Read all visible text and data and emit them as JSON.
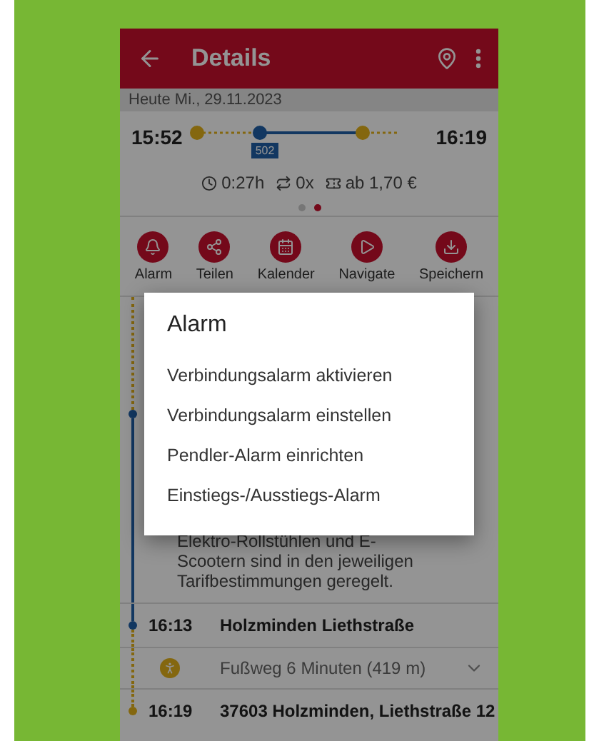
{
  "app_bar": {
    "title": "Details"
  },
  "date": "Heute Mi., 29.11.2023",
  "summary": {
    "departure": "15:52",
    "arrival": "16:19",
    "line": "502",
    "duration": "0:27h",
    "changes": "0x",
    "price": "ab 1,70 €",
    "pages": [
      {
        "selected": false
      },
      {
        "selected": true
      }
    ]
  },
  "actions": [
    {
      "label": "Alarm",
      "kind": "bell"
    },
    {
      "label": "Teilen",
      "kind": "share"
    },
    {
      "label": "Kalender",
      "kind": "calendar"
    },
    {
      "label": "Navigate",
      "kind": "play"
    },
    {
      "label": "Speichern",
      "kind": "save"
    }
  ],
  "note": "Elektro-Rollstühlen und E-Scootern sind in den jeweiligen Tarifbestimmungen geregelt.",
  "legs": [
    {
      "kind": "stop",
      "time": "16:13",
      "place": "Holzminden Liethstraße",
      "walk_above": false
    },
    {
      "kind": "walk",
      "text": "Fußweg 6 Minuten (419 m)"
    },
    {
      "kind": "stop",
      "time": "16:19",
      "place": "37603 Holzminden, Liethstraße 12",
      "walk_above": true
    }
  ],
  "dialog": {
    "title": "Alarm",
    "items": [
      "Verbindungsalarm aktivieren",
      "Verbindungsalarm einstellen",
      "Pendler-Alarm einrichten",
      "Einstiegs-/Ausstiegs-Alarm"
    ]
  }
}
